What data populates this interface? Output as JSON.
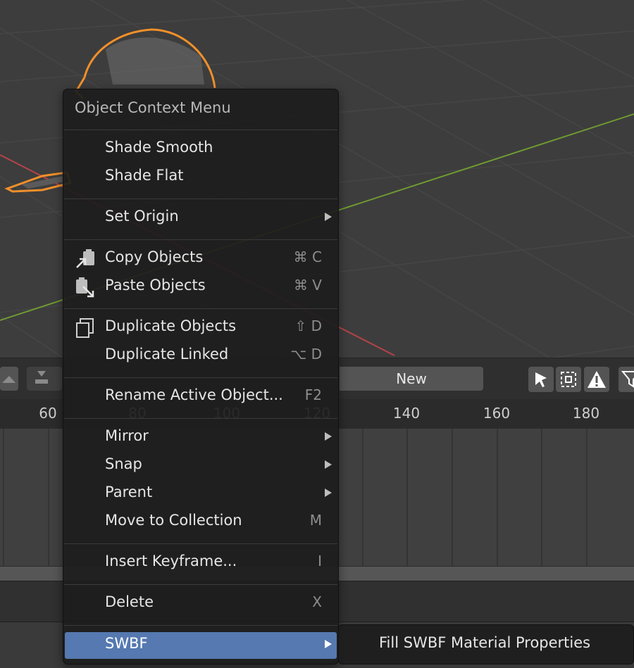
{
  "timeline": {
    "new_label": "New",
    "ruler": [
      "60",
      "80",
      "100",
      "120",
      "140",
      "160",
      "180"
    ]
  },
  "menu": {
    "title": "Object Context Menu",
    "items": {
      "shade_smooth": {
        "label": "Shade Smooth"
      },
      "shade_flat": {
        "label": "Shade Flat"
      },
      "set_origin": {
        "label": "Set Origin"
      },
      "copy_objects": {
        "label": "Copy Objects",
        "shortcut": "⌘ C"
      },
      "paste_objects": {
        "label": "Paste Objects",
        "shortcut": "⌘ V"
      },
      "duplicate_objects": {
        "label": "Duplicate Objects",
        "shortcut": "⇧ D"
      },
      "duplicate_linked": {
        "label": "Duplicate Linked",
        "shortcut": "⌥ D"
      },
      "rename_active": {
        "label": "Rename Active Object...",
        "shortcut": "F2"
      },
      "mirror": {
        "label": "Mirror"
      },
      "snap": {
        "label": "Snap"
      },
      "parent": {
        "label": "Parent"
      },
      "move_to_collection": {
        "label": "Move to Collection",
        "shortcut": "M"
      },
      "insert_keyframe": {
        "label": "Insert Keyframe...",
        "shortcut": "I"
      },
      "delete": {
        "label": "Delete",
        "shortcut": "X"
      },
      "swbf": {
        "label": "SWBF"
      }
    }
  },
  "submenu": {
    "fill_swbf": {
      "label": "Fill SWBF Material Properties"
    }
  },
  "colors": {
    "accent": "#5579b0",
    "selection_outline": "#f0902a",
    "axis_x": "#b5434a",
    "axis_y": "#6f9a31"
  }
}
